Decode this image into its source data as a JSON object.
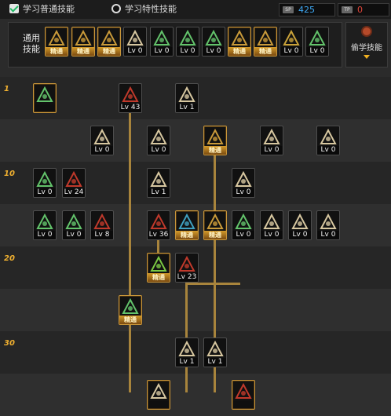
{
  "tabs": [
    {
      "label": "学习普通技能",
      "state": "checked",
      "icon": "checkbox-checked-icon"
    },
    {
      "label": "学习特性技能",
      "state": "radio",
      "icon": "radio-icon"
    }
  ],
  "currency": [
    {
      "icon": "sp-icon",
      "value": "425",
      "color": "#3fa9f5"
    },
    {
      "icon": "tp-icon",
      "value": "0",
      "color": "#e0453a"
    }
  ],
  "common_skills": {
    "label": "通用技能",
    "slots": [
      {
        "text": "精通",
        "kind": "mastered",
        "color": "#c99a3a",
        "icon": "shout-icon"
      },
      {
        "text": "精通",
        "kind": "mastered",
        "color": "#c99a3a",
        "icon": "leap-icon"
      },
      {
        "text": "精通",
        "kind": "mastered",
        "color": "#c99a3a",
        "icon": "run-icon"
      },
      {
        "text": "Lv 0",
        "kind": "level",
        "color": "#d7c7a0",
        "icon": "wing-icon"
      },
      {
        "text": "Lv 0",
        "kind": "level",
        "color": "#63c36b",
        "icon": "target-icon"
      },
      {
        "text": "Lv 0",
        "kind": "level",
        "color": "#63c36b",
        "icon": "target-icon"
      },
      {
        "text": "Lv 0",
        "kind": "level",
        "color": "#63c36b",
        "icon": "climb-icon"
      },
      {
        "text": "精通",
        "kind": "mastered",
        "color": "#c99a3a",
        "icon": "rage-icon"
      },
      {
        "text": "精通",
        "kind": "mastered",
        "color": "#c99a3a",
        "icon": "eye-icon"
      },
      {
        "text": "Lv 0",
        "kind": "level",
        "color": "#c9a23a",
        "icon": "warrior-icon"
      },
      {
        "text": "Lv 0",
        "kind": "level",
        "color": "#63c36b",
        "icon": "sprint-icon"
      }
    ]
  },
  "steal_button": {
    "label": "偷学技能",
    "icon": "steal-icon"
  },
  "level_markers": [
    "1",
    "10",
    "20",
    "30"
  ],
  "tree_skills": [
    {
      "text": "",
      "kind": "none",
      "color": "#63c36b",
      "icon": "ghost-icon"
    },
    {
      "text": "Lv 43",
      "kind": "level",
      "color": "#c0392b",
      "icon": "slash-icon"
    },
    {
      "text": "Lv 1",
      "kind": "level",
      "color": "#d7c7a0",
      "icon": "blade-icon"
    },
    {
      "text": "Lv 0",
      "kind": "level",
      "color": "#d7c7a0",
      "icon": "claw-icon"
    },
    {
      "text": "Lv 0",
      "kind": "level",
      "color": "#d7c7a0",
      "icon": "arrow-icon"
    },
    {
      "text": "精通",
      "kind": "mastered",
      "color": "#c99a3a",
      "icon": "whirl-icon"
    },
    {
      "text": "Lv 0",
      "kind": "level",
      "color": "#d7c7a0",
      "icon": "shield-icon"
    },
    {
      "text": "Lv 0",
      "kind": "level",
      "color": "#d7c7a0",
      "icon": "triple-icon"
    },
    {
      "text": "Lv 0",
      "kind": "level",
      "color": "#63c36b",
      "icon": "sword-icon"
    },
    {
      "text": "Lv 24",
      "kind": "level",
      "color": "#c0392b",
      "icon": "dagger-icon"
    },
    {
      "text": "Lv 1",
      "kind": "level",
      "color": "#d7c7a0",
      "icon": "flame-icon"
    },
    {
      "text": "Lv 0",
      "kind": "level",
      "color": "#d7c7a0",
      "icon": "spin-icon"
    },
    {
      "text": "Lv 0",
      "kind": "level",
      "color": "#63c36b",
      "icon": "sword-icon"
    },
    {
      "text": "Lv 0",
      "kind": "level",
      "color": "#63c36b",
      "icon": "burst-icon"
    },
    {
      "text": "Lv 8",
      "kind": "level",
      "color": "#c0392b",
      "icon": "dagger-icon"
    },
    {
      "text": "Lv 36",
      "kind": "level",
      "color": "#c0392b",
      "icon": "crescent-icon"
    },
    {
      "text": "精通",
      "kind": "mastered",
      "color": "#3fa0c0",
      "icon": "guard-icon"
    },
    {
      "text": "精通",
      "kind": "mastered",
      "color": "#c99a3a",
      "icon": "beast-icon"
    },
    {
      "text": "Lv 0",
      "kind": "level",
      "color": "#63c36b",
      "icon": "crescent-icon"
    },
    {
      "text": "Lv 0",
      "kind": "level",
      "color": "#d7c7a0",
      "icon": "blade-icon"
    },
    {
      "text": "Lv 0",
      "kind": "level",
      "color": "#d7c7a0",
      "icon": "cross-icon"
    },
    {
      "text": "Lv 0",
      "kind": "level",
      "color": "#d7c7a0",
      "icon": "strike-icon"
    },
    {
      "text": "精通",
      "kind": "mastered",
      "color": "#7ac843",
      "icon": "orb-icon"
    },
    {
      "text": "Lv 23",
      "kind": "level",
      "color": "#c0392b",
      "icon": "pillar-icon"
    },
    {
      "text": "精通",
      "kind": "mastered",
      "color": "#63c36b",
      "icon": "wave-icon"
    },
    {
      "text": "Lv 1",
      "kind": "level",
      "color": "#d7c7a0",
      "icon": "dash-icon"
    },
    {
      "text": "Lv 1",
      "kind": "level",
      "color": "#d7c7a0",
      "icon": "fist-icon"
    },
    {
      "text": "",
      "kind": "none",
      "color": "#d7c7a0",
      "icon": "statue-icon"
    },
    {
      "text": "",
      "kind": "none",
      "color": "#c0392b",
      "icon": "slash-icon"
    }
  ]
}
